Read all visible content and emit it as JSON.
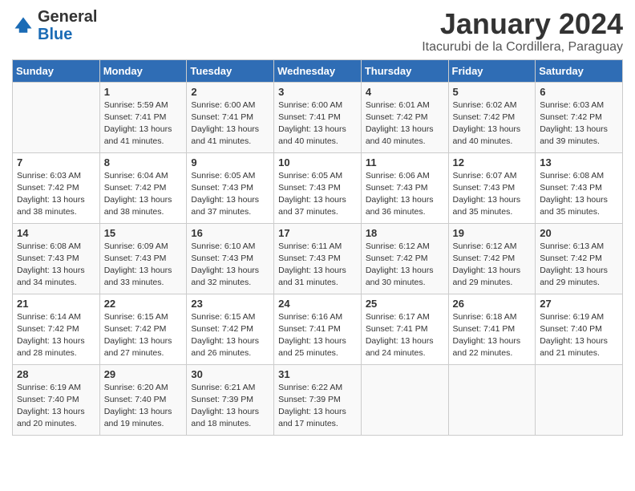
{
  "header": {
    "logo_general": "General",
    "logo_blue": "Blue",
    "title": "January 2024",
    "subtitle": "Itacurubi de la Cordillera, Paraguay"
  },
  "weekdays": [
    "Sunday",
    "Monday",
    "Tuesday",
    "Wednesday",
    "Thursday",
    "Friday",
    "Saturday"
  ],
  "weeks": [
    [
      {
        "day": "",
        "info": ""
      },
      {
        "day": "1",
        "info": "Sunrise: 5:59 AM\nSunset: 7:41 PM\nDaylight: 13 hours\nand 41 minutes."
      },
      {
        "day": "2",
        "info": "Sunrise: 6:00 AM\nSunset: 7:41 PM\nDaylight: 13 hours\nand 41 minutes."
      },
      {
        "day": "3",
        "info": "Sunrise: 6:00 AM\nSunset: 7:41 PM\nDaylight: 13 hours\nand 40 minutes."
      },
      {
        "day": "4",
        "info": "Sunrise: 6:01 AM\nSunset: 7:42 PM\nDaylight: 13 hours\nand 40 minutes."
      },
      {
        "day": "5",
        "info": "Sunrise: 6:02 AM\nSunset: 7:42 PM\nDaylight: 13 hours\nand 40 minutes."
      },
      {
        "day": "6",
        "info": "Sunrise: 6:03 AM\nSunset: 7:42 PM\nDaylight: 13 hours\nand 39 minutes."
      }
    ],
    [
      {
        "day": "7",
        "info": "Sunrise: 6:03 AM\nSunset: 7:42 PM\nDaylight: 13 hours\nand 38 minutes."
      },
      {
        "day": "8",
        "info": "Sunrise: 6:04 AM\nSunset: 7:42 PM\nDaylight: 13 hours\nand 38 minutes."
      },
      {
        "day": "9",
        "info": "Sunrise: 6:05 AM\nSunset: 7:43 PM\nDaylight: 13 hours\nand 37 minutes."
      },
      {
        "day": "10",
        "info": "Sunrise: 6:05 AM\nSunset: 7:43 PM\nDaylight: 13 hours\nand 37 minutes."
      },
      {
        "day": "11",
        "info": "Sunrise: 6:06 AM\nSunset: 7:43 PM\nDaylight: 13 hours\nand 36 minutes."
      },
      {
        "day": "12",
        "info": "Sunrise: 6:07 AM\nSunset: 7:43 PM\nDaylight: 13 hours\nand 35 minutes."
      },
      {
        "day": "13",
        "info": "Sunrise: 6:08 AM\nSunset: 7:43 PM\nDaylight: 13 hours\nand 35 minutes."
      }
    ],
    [
      {
        "day": "14",
        "info": "Sunrise: 6:08 AM\nSunset: 7:43 PM\nDaylight: 13 hours\nand 34 minutes."
      },
      {
        "day": "15",
        "info": "Sunrise: 6:09 AM\nSunset: 7:43 PM\nDaylight: 13 hours\nand 33 minutes."
      },
      {
        "day": "16",
        "info": "Sunrise: 6:10 AM\nSunset: 7:43 PM\nDaylight: 13 hours\nand 32 minutes."
      },
      {
        "day": "17",
        "info": "Sunrise: 6:11 AM\nSunset: 7:43 PM\nDaylight: 13 hours\nand 31 minutes."
      },
      {
        "day": "18",
        "info": "Sunrise: 6:12 AM\nSunset: 7:42 PM\nDaylight: 13 hours\nand 30 minutes."
      },
      {
        "day": "19",
        "info": "Sunrise: 6:12 AM\nSunset: 7:42 PM\nDaylight: 13 hours\nand 29 minutes."
      },
      {
        "day": "20",
        "info": "Sunrise: 6:13 AM\nSunset: 7:42 PM\nDaylight: 13 hours\nand 29 minutes."
      }
    ],
    [
      {
        "day": "21",
        "info": "Sunrise: 6:14 AM\nSunset: 7:42 PM\nDaylight: 13 hours\nand 28 minutes."
      },
      {
        "day": "22",
        "info": "Sunrise: 6:15 AM\nSunset: 7:42 PM\nDaylight: 13 hours\nand 27 minutes."
      },
      {
        "day": "23",
        "info": "Sunrise: 6:15 AM\nSunset: 7:42 PM\nDaylight: 13 hours\nand 26 minutes."
      },
      {
        "day": "24",
        "info": "Sunrise: 6:16 AM\nSunset: 7:41 PM\nDaylight: 13 hours\nand 25 minutes."
      },
      {
        "day": "25",
        "info": "Sunrise: 6:17 AM\nSunset: 7:41 PM\nDaylight: 13 hours\nand 24 minutes."
      },
      {
        "day": "26",
        "info": "Sunrise: 6:18 AM\nSunset: 7:41 PM\nDaylight: 13 hours\nand 22 minutes."
      },
      {
        "day": "27",
        "info": "Sunrise: 6:19 AM\nSunset: 7:40 PM\nDaylight: 13 hours\nand 21 minutes."
      }
    ],
    [
      {
        "day": "28",
        "info": "Sunrise: 6:19 AM\nSunset: 7:40 PM\nDaylight: 13 hours\nand 20 minutes."
      },
      {
        "day": "29",
        "info": "Sunrise: 6:20 AM\nSunset: 7:40 PM\nDaylight: 13 hours\nand 19 minutes."
      },
      {
        "day": "30",
        "info": "Sunrise: 6:21 AM\nSunset: 7:39 PM\nDaylight: 13 hours\nand 18 minutes."
      },
      {
        "day": "31",
        "info": "Sunrise: 6:22 AM\nSunset: 7:39 PM\nDaylight: 13 hours\nand 17 minutes."
      },
      {
        "day": "",
        "info": ""
      },
      {
        "day": "",
        "info": ""
      },
      {
        "day": "",
        "info": ""
      }
    ]
  ]
}
